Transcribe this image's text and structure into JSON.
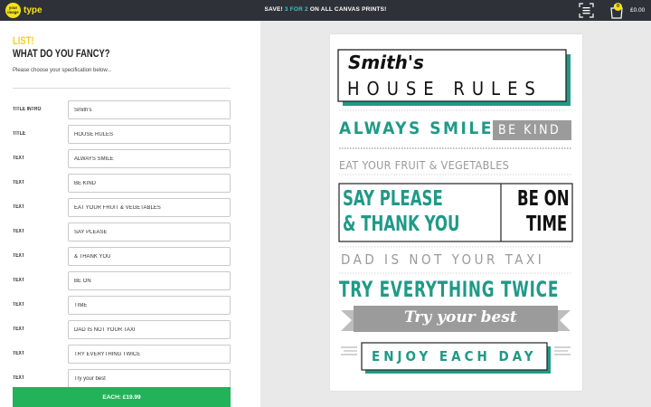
{
  "header": {
    "logo_top": "your",
    "logo_mid": "image",
    "logo_bottom": "type",
    "logo_word": "type",
    "promo_prefix": "SAVE!",
    "promo_highlight": "3 FOR 2",
    "promo_suffix": "ON ALL CANVAS PRINTS!",
    "cart_count": "0",
    "cart_total": "£0.00"
  },
  "form": {
    "heading_line1": "LIST!",
    "heading_line2": "WHAT DO YOU FANCY?",
    "subtext": "Please choose your specification below...",
    "fields": [
      {
        "label": "TITLE INTRO",
        "value": "Smith's"
      },
      {
        "label": "TITLE",
        "value": "HOUSE RULES"
      },
      {
        "label": "TEXT",
        "value": "ALWAYS SMILE"
      },
      {
        "label": "TEXT",
        "value": "BE KIND"
      },
      {
        "label": "TEXT",
        "value": "EAT YOUR FRUIT & VEGETABLES"
      },
      {
        "label": "TEXT",
        "value": "SAY PLEASE"
      },
      {
        "label": "TEXT",
        "value": "& THANK YOU"
      },
      {
        "label": "TEXT",
        "value": "BE ON"
      },
      {
        "label": "TEXT",
        "value": "TIME"
      },
      {
        "label": "TEXT",
        "value": "DAD IS NOT YOUR TAXI"
      },
      {
        "label": "TEXT",
        "value": "TRY EVERYTHING TWICE"
      },
      {
        "label": "TEXT",
        "value": "Try your best"
      }
    ],
    "buy_label": "EACH: £19.99"
  },
  "poster": {
    "title_intro": "Smith's",
    "title": "HOUSE RULES",
    "line_always_smile": "ALWAYS SMILE",
    "line_be_kind": "BE KIND",
    "line_eat": "EAT YOUR FRUIT & VEGETABLES",
    "line_say_please": "SAY PLEASE",
    "line_thank_you": "& THANK YOU",
    "line_be_on": "BE ON",
    "line_time": "TIME",
    "line_dad": "DAD IS NOT YOUR TAXI",
    "line_try_everything": "TRY EVERYTHING TWICE",
    "line_try_best": "Try your best",
    "line_enjoy": "ENJOY EACH DAY"
  },
  "colors": {
    "teal": "#1f9a87",
    "grey": "#9a9a9a",
    "topbar": "#2e3238",
    "buy": "#21b25a",
    "yellow": "#f6e21a"
  }
}
